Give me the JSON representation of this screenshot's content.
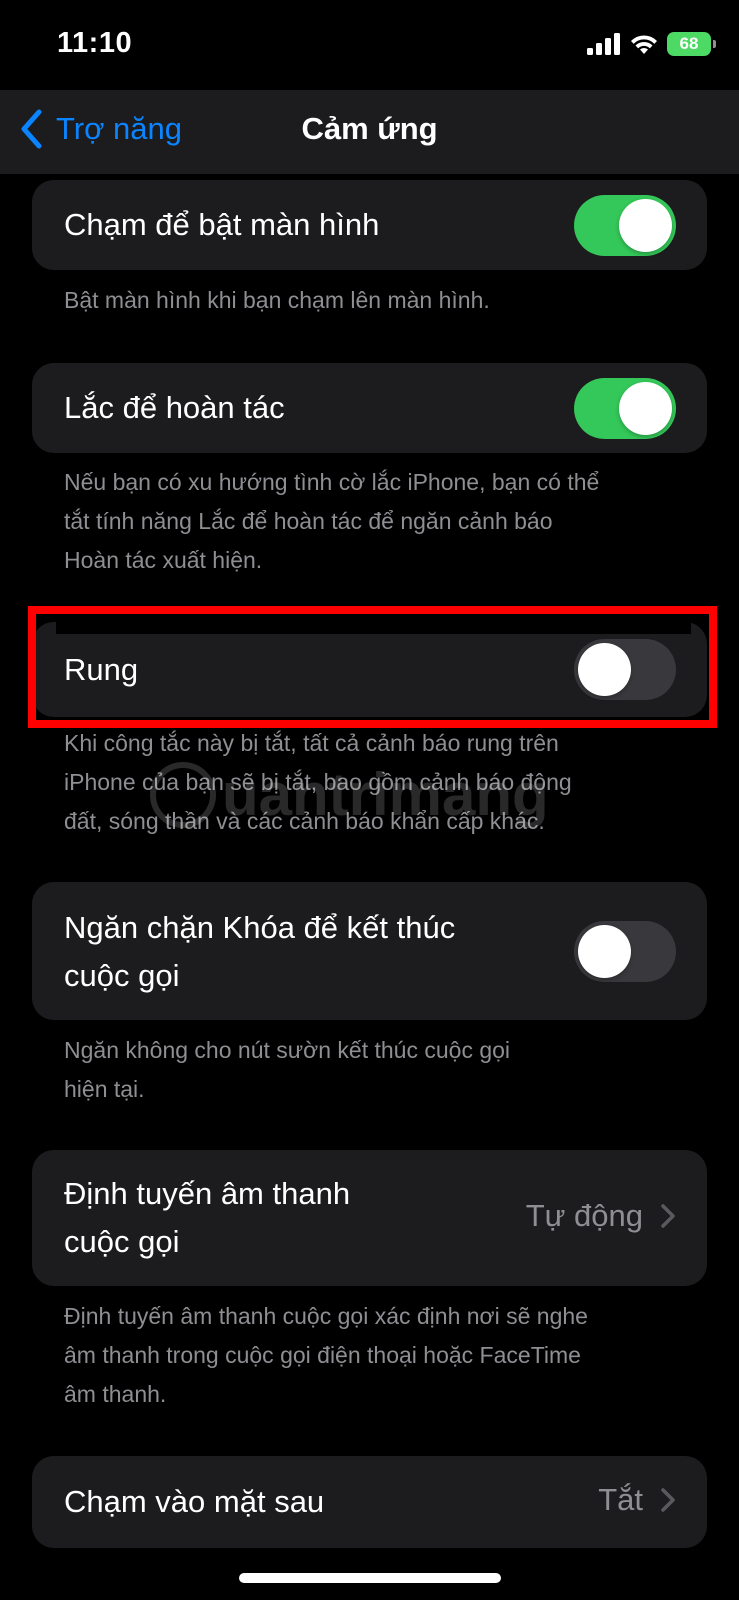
{
  "status_bar": {
    "time": "11:10",
    "battery": "68"
  },
  "nav": {
    "back_label": "Trợ năng",
    "title": "Cảm ứng"
  },
  "settings": [
    {
      "label": "Chạm để bật màn hình",
      "toggle_on": true,
      "footer": [
        "Bật màn hình khi bạn chạm lên màn hình."
      ]
    },
    {
      "label": "Lắc để hoàn tác",
      "toggle_on": true,
      "footer": [
        "Nếu bạn có xu hướng tình cờ lắc iPhone, bạn có thể",
        "tắt tính năng Lắc để hoàn tác để ngăn cảnh báo",
        "Hoàn tác xuất hiện."
      ]
    },
    {
      "label": "Rung",
      "toggle_on": false,
      "footer": [
        "Khi công tắc này bị tắt, tất cả cảnh báo rung trên",
        "iPhone của bạn sẽ bị tắt, bao gồm cảnh báo động",
        "đất, sóng thần và các cảnh báo khẩn cấp khác."
      ]
    },
    {
      "label_lines": [
        "Ngăn chặn Khóa để kết thúc",
        "cuộc gọi"
      ],
      "toggle_on": false,
      "footer": [
        "Ngăn không cho nút sườn kết thúc cuộc gọi",
        "hiện tại."
      ]
    },
    {
      "label_lines": [
        "Định tuyến âm thanh",
        "cuộc gọi"
      ],
      "value": "Tự động",
      "footer": [
        "Định tuyến âm thanh cuộc gọi xác định nơi sẽ nghe",
        "âm thanh trong cuộc gọi điện thoại hoặc FaceTime",
        "âm thanh."
      ]
    },
    {
      "label": "Chạm vào mặt sau",
      "value": "Tắt"
    }
  ],
  "watermark": "uantrimang",
  "colors": {
    "accent": "#0a84ff",
    "toggle_on": "#34c759",
    "toggle_off": "#39393d",
    "highlight": "#ff0000",
    "cell_bg": "#1c1c1e"
  },
  "icons": [
    "cellular-signal-icon",
    "wifi-icon",
    "battery-icon",
    "chevron-left-icon",
    "chevron-right-icon"
  ]
}
